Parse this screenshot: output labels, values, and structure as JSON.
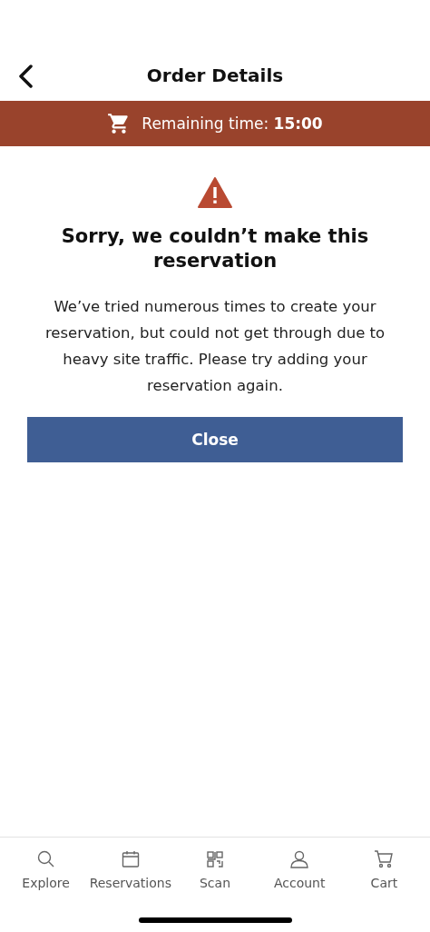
{
  "header": {
    "title": "Order Details"
  },
  "timer_banner": {
    "text": "Remaining time: **15:00**"
  },
  "error": {
    "title": "Sorry, we couldn’t make this reservation",
    "message": "We’ve tried numerous times to create your reservation, but could not get through due to heavy site traffic. Please try adding your reservation again.",
    "button": "Close"
  },
  "tab_bar": [
    {
      "label": "Explore",
      "kind": "search"
    },
    {
      "label": "Reservations",
      "kind": "calendar"
    },
    {
      "label": "Scan",
      "kind": "qr"
    },
    {
      "label": "Account",
      "kind": "person"
    },
    {
      "label": "Cart",
      "kind": "cart"
    }
  ]
}
